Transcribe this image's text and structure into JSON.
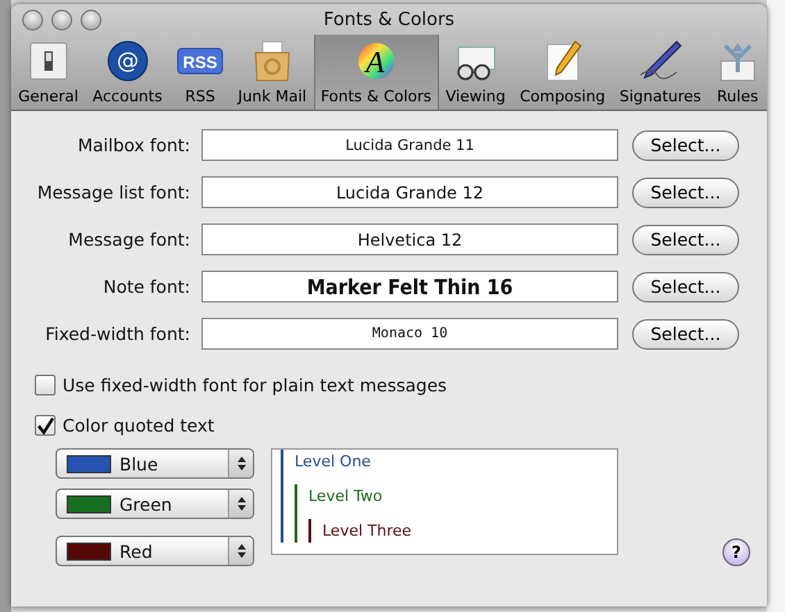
{
  "window": {
    "title": "Fonts & Colors"
  },
  "toolbar": [
    {
      "label": "General",
      "kind": "switch",
      "selected": false
    },
    {
      "label": "Accounts",
      "kind": "at",
      "glyph": "@",
      "selected": false
    },
    {
      "label": "RSS",
      "kind": "rss",
      "glyph": "RSS",
      "selected": false
    },
    {
      "label": "Junk Mail",
      "kind": "bag",
      "selected": false
    },
    {
      "label": "Fonts & Colors",
      "kind": "fonts",
      "glyph": "A",
      "selected": true
    },
    {
      "label": "Viewing",
      "kind": "glasses",
      "selected": false
    },
    {
      "label": "Composing",
      "kind": "pencil",
      "selected": false
    },
    {
      "label": "Signatures",
      "kind": "pen",
      "selected": false
    },
    {
      "label": "Rules",
      "kind": "arrows",
      "selected": false
    }
  ],
  "font_rows": [
    {
      "label": "Mailbox font:",
      "value": "Lucida Grande 11",
      "kind": "small",
      "button": "Select..."
    },
    {
      "label": "Message list font:",
      "value": "Lucida Grande 12",
      "kind": "sans",
      "button": "Select..."
    },
    {
      "label": "Message font:",
      "value": "Helvetica 12",
      "kind": "sans",
      "button": "Select..."
    },
    {
      "label": "Note font:",
      "value": "Marker Felt Thin 16",
      "kind": "marker",
      "button": "Select..."
    },
    {
      "label": "Fixed-width font:",
      "value": "Monaco 10",
      "kind": "mono",
      "button": "Select..."
    }
  ],
  "checkboxes": [
    {
      "label": "Use fixed-width font for plain text messages",
      "checked": false
    },
    {
      "label": "Color quoted text",
      "checked": true
    }
  ],
  "quote_colors": [
    {
      "label": "Blue",
      "color": "#2553b0"
    },
    {
      "label": "Green",
      "color": "#17701f"
    },
    {
      "label": "Red",
      "color": "#560808"
    }
  ],
  "preview": {
    "text": "Level One",
    "color": "#2a4f96",
    "children": [
      {
        "text": "Level Two",
        "color": "#1e6b1e",
        "children": [
          {
            "text": "Level Three",
            "color": "#5a1010"
          }
        ]
      }
    ]
  },
  "help_button": {
    "label": "?"
  }
}
